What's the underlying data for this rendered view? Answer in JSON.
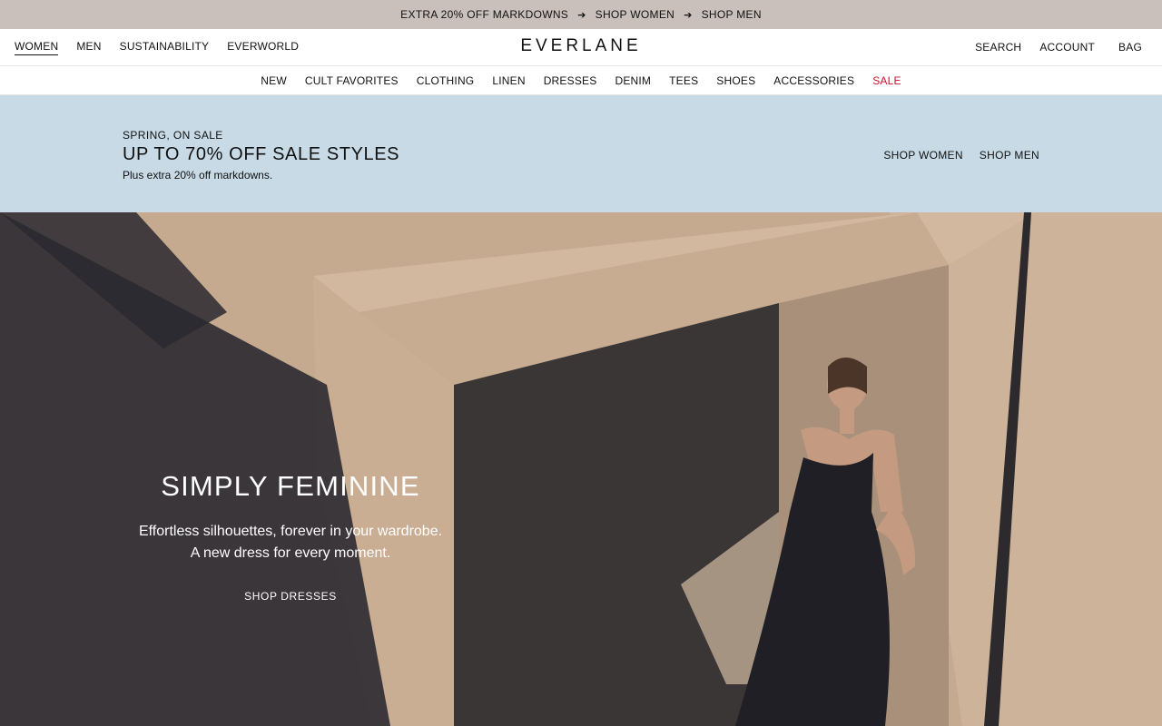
{
  "promo": {
    "text": "EXTRA 20% OFF MARKDOWNS",
    "arrow_icon": "right-arrow-icon",
    "links": [
      "SHOP WOMEN",
      "SHOP MEN"
    ]
  },
  "header": {
    "logo": "EVERLANE",
    "left_nav": [
      "WOMEN",
      "MEN",
      "SUSTAINABILITY",
      "EVERWORLD"
    ],
    "active_left_nav": "WOMEN",
    "right_nav": [
      "SEARCH",
      "ACCOUNT",
      "BAG"
    ]
  },
  "category_nav": [
    "NEW",
    "CULT FAVORITES",
    "CLOTHING",
    "LINEN",
    "DRESSES",
    "DENIM",
    "TEES",
    "SHOES",
    "ACCESSORIES",
    "SALE"
  ],
  "sale_banner": {
    "eyebrow": "SPRING, ON SALE",
    "headline": "UP TO 70% OFF SALE STYLES",
    "subtext": "Plus extra 20% off markdowns.",
    "links": [
      "SHOP WOMEN",
      "SHOP MEN"
    ]
  },
  "hero": {
    "title": "SIMPLY FEMININE",
    "line1": "Effortless silhouettes, forever in your wardrobe.",
    "line2": "A new dress for every moment.",
    "cta": "SHOP DRESSES"
  },
  "colors": {
    "promo_bg": "#c9c0bb",
    "banner_bg": "#c7dae6",
    "sale_red": "#c3142a"
  }
}
